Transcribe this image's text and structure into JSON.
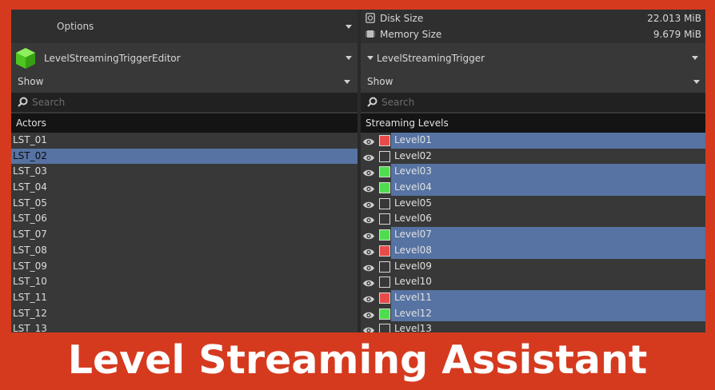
{
  "left": {
    "options_label": "Options",
    "asset_label": "LevelStreamingTriggerEditor",
    "show_label": "Show",
    "search_placeholder": "Search",
    "column_header": "Actors",
    "actors": [
      {
        "name": "LST_01",
        "selected": false
      },
      {
        "name": "LST_02",
        "selected": true
      },
      {
        "name": "LST_03",
        "selected": false
      },
      {
        "name": "LST_04",
        "selected": false
      },
      {
        "name": "LST_05",
        "selected": false
      },
      {
        "name": "LST_06",
        "selected": false
      },
      {
        "name": "LST_07",
        "selected": false
      },
      {
        "name": "LST_08",
        "selected": false
      },
      {
        "name": "LST_09",
        "selected": false
      },
      {
        "name": "LST_10",
        "selected": false
      },
      {
        "name": "LST_11",
        "selected": false
      },
      {
        "name": "LST_12",
        "selected": false
      },
      {
        "name": "LST_13",
        "selected": false
      }
    ]
  },
  "right": {
    "stats": [
      {
        "label": "Disk Size",
        "value": "22.013 MiB",
        "icon": "disk-icon"
      },
      {
        "label": "Memory Size",
        "value": "9.679 MiB",
        "icon": "memory-chip-icon"
      }
    ],
    "asset_label": "LevelStreamingTrigger",
    "show_label": "Show",
    "search_placeholder": "Search",
    "column_header": "Streaming Levels",
    "levels": [
      {
        "name": "Level01",
        "state": "red",
        "highlighted": true
      },
      {
        "name": "Level02",
        "state": "empty",
        "highlighted": false
      },
      {
        "name": "Level03",
        "state": "green",
        "highlighted": true
      },
      {
        "name": "Level04",
        "state": "green",
        "highlighted": true
      },
      {
        "name": "Level05",
        "state": "empty",
        "highlighted": false
      },
      {
        "name": "Level06",
        "state": "empty",
        "highlighted": false
      },
      {
        "name": "Level07",
        "state": "green",
        "highlighted": true
      },
      {
        "name": "Level08",
        "state": "red",
        "highlighted": true
      },
      {
        "name": "Level09",
        "state": "empty",
        "highlighted": false
      },
      {
        "name": "Level10",
        "state": "empty",
        "highlighted": false
      },
      {
        "name": "Level11",
        "state": "red",
        "highlighted": true
      },
      {
        "name": "Level12",
        "state": "green",
        "highlighted": true
      },
      {
        "name": "Level13",
        "state": "empty",
        "highlighted": false
      }
    ]
  },
  "banner": "Level Streaming Assistant",
  "colors": {
    "frame": "#d53a1f",
    "panel": "#383838",
    "selection": "#5673a3",
    "swatch_red": "#e94b4b",
    "swatch_green": "#4fdc4f",
    "cube_green": "#5ee02e"
  }
}
